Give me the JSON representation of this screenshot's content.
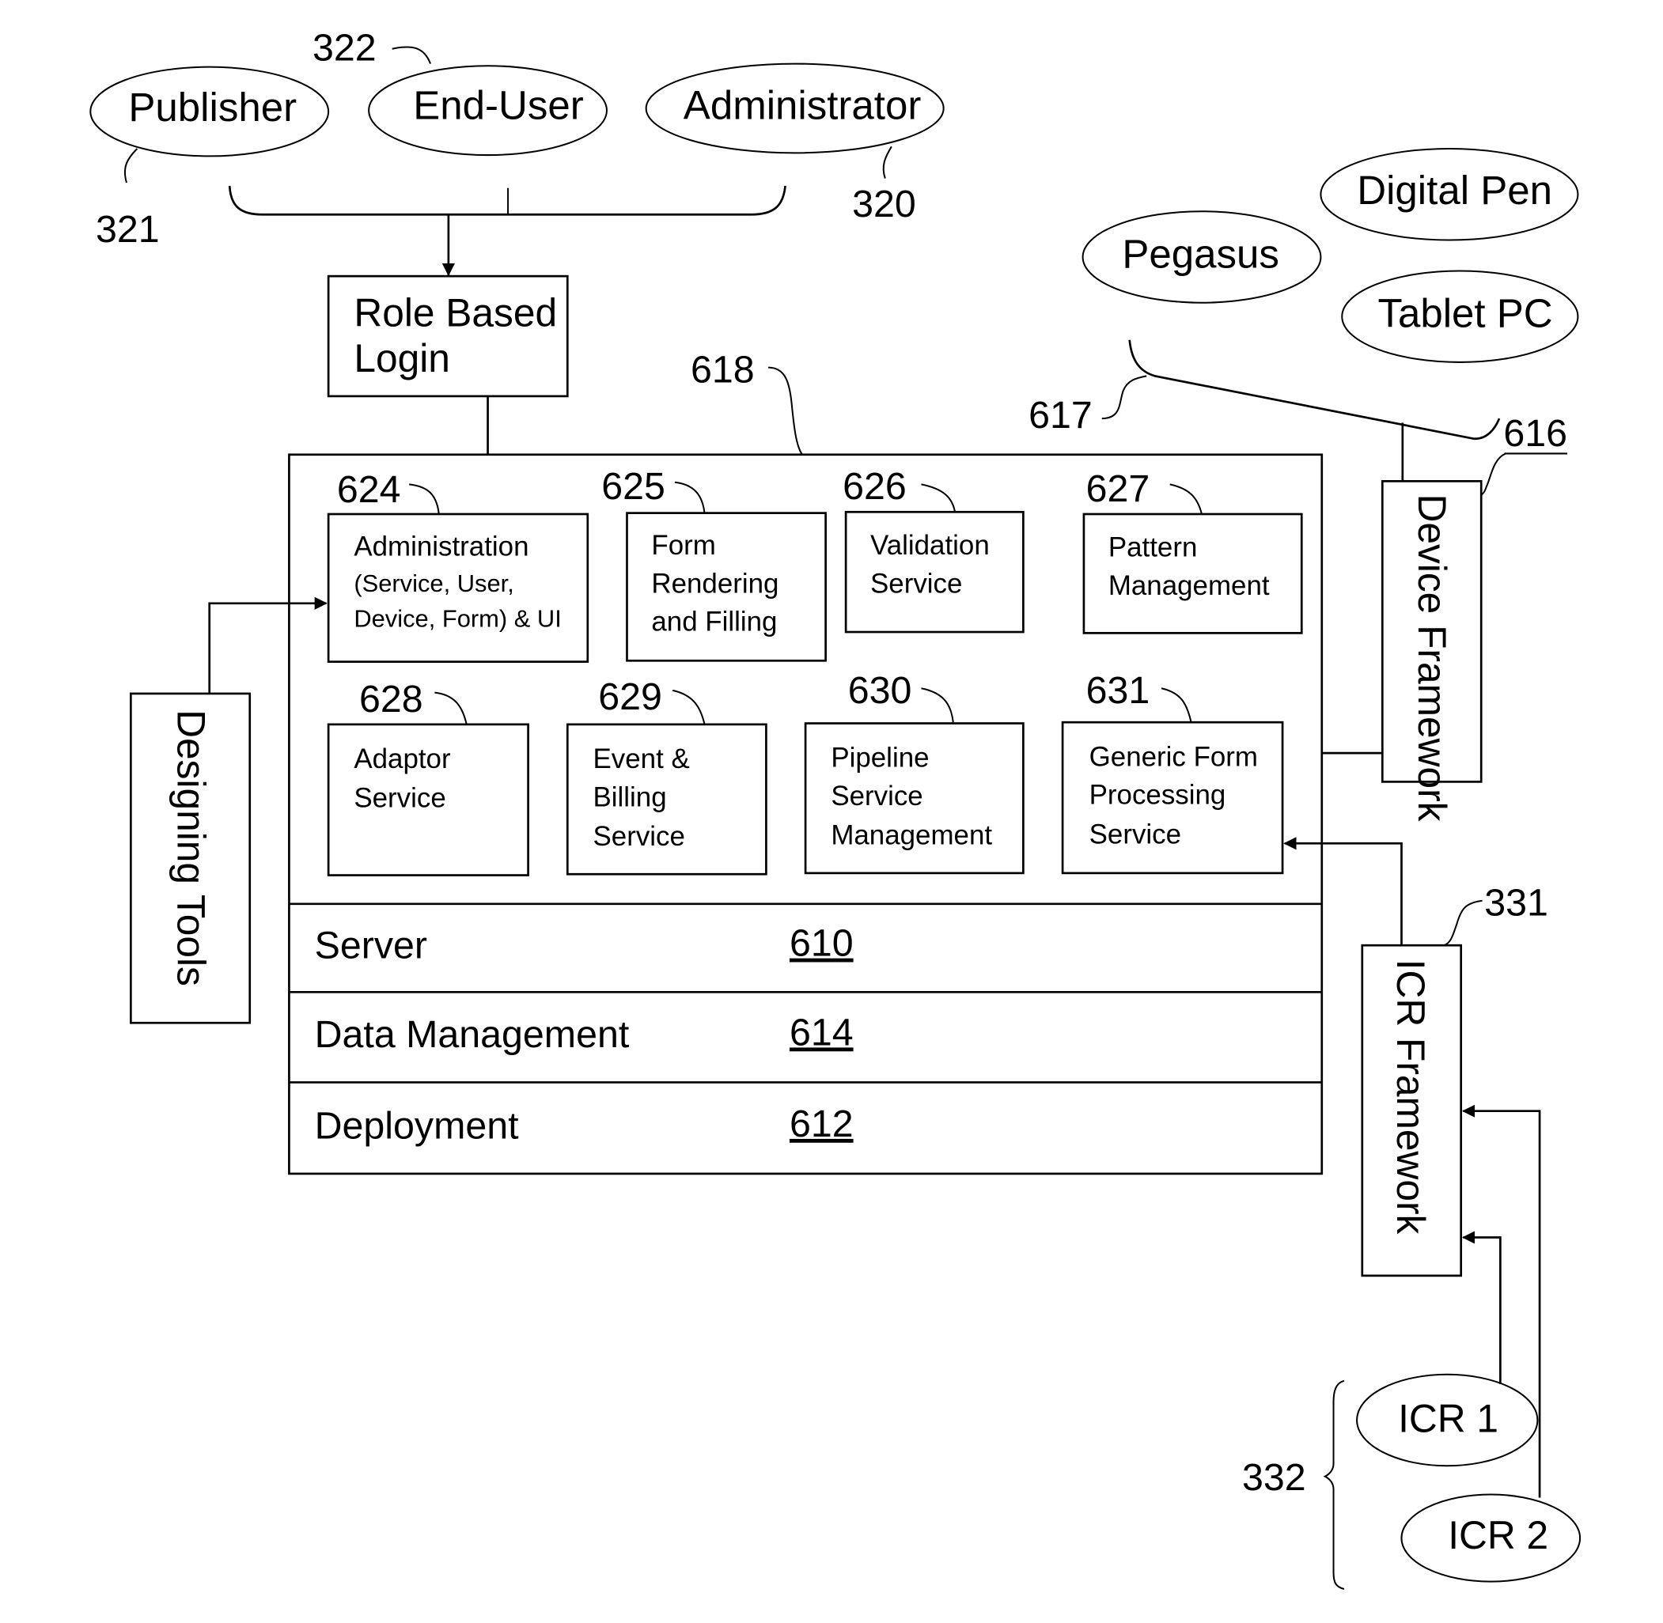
{
  "roles": {
    "publisher": "Publisher",
    "end_user": "End-User",
    "administrator": "Administrator",
    "ref_321": "321",
    "ref_322": "322",
    "ref_320": "320"
  },
  "login": {
    "line1": "Role Based",
    "line2": "Login"
  },
  "devices": {
    "pegasus": "Pegasus",
    "digital_pen": "Digital Pen",
    "tablet_pc": "Tablet PC",
    "ref_617": "617",
    "ref_616": "616"
  },
  "platform": {
    "ref_618": "618",
    "services": [
      {
        "ref": "624",
        "lines": [
          "Administration",
          "(Service, User,",
          "Device, Form) & UI"
        ]
      },
      {
        "ref": "625",
        "lines": [
          "Form",
          "Rendering",
          "and Filling"
        ]
      },
      {
        "ref": "626",
        "lines": [
          "Validation",
          "Service"
        ]
      },
      {
        "ref": "627",
        "lines": [
          "Pattern",
          "Management"
        ]
      },
      {
        "ref": "628",
        "lines": [
          "Adaptor",
          "Service"
        ]
      },
      {
        "ref": "629",
        "lines": [
          "Event  &",
          "Billing",
          "Service"
        ]
      },
      {
        "ref": "630",
        "lines": [
          "Pipeline",
          "Service",
          "Management"
        ]
      },
      {
        "ref": "631",
        "lines": [
          "Generic Form",
          "Processing",
          "Service"
        ]
      }
    ],
    "layers": [
      {
        "label": "Server",
        "ref": "610"
      },
      {
        "label": "Data Management",
        "ref": "614"
      },
      {
        "label": "Deployment",
        "ref": "612"
      }
    ]
  },
  "designing_tools": "Designing Tools",
  "device_framework": "Device Framework",
  "icr": {
    "framework": "ICR Framework",
    "ref_331": "331",
    "ref_332": "332",
    "icr1": "ICR 1",
    "icr2": "ICR 2"
  }
}
